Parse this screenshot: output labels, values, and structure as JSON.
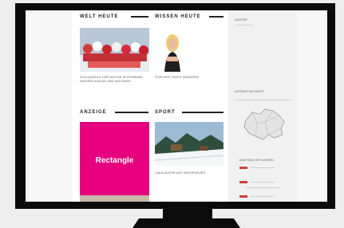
{
  "sections": {
    "welt_heute": "WELT HEUTE",
    "wissen_heute": "WISSEN HEUTE",
    "anzeige": "ANZEIGE",
    "sport": "SPORT"
  },
  "articles": {
    "welt_caption": "Schlagzeile der Woche Skiverband Europa League und Nationen",
    "wissen_caption": "Star des Tages Sängerin",
    "sport_caption": "Langläufer auf Rekordkurs"
  },
  "ad": {
    "label": "Rectangle",
    "color": "#e6007e"
  },
  "sidebar": {
    "anzeige_label": "Anzeige",
    "map_title": "Interaktive Karte",
    "map_caption": "Kantone der Schweiz"
  },
  "colors": {
    "bezel": "#0b0b0b",
    "accent": "#e6007e"
  }
}
